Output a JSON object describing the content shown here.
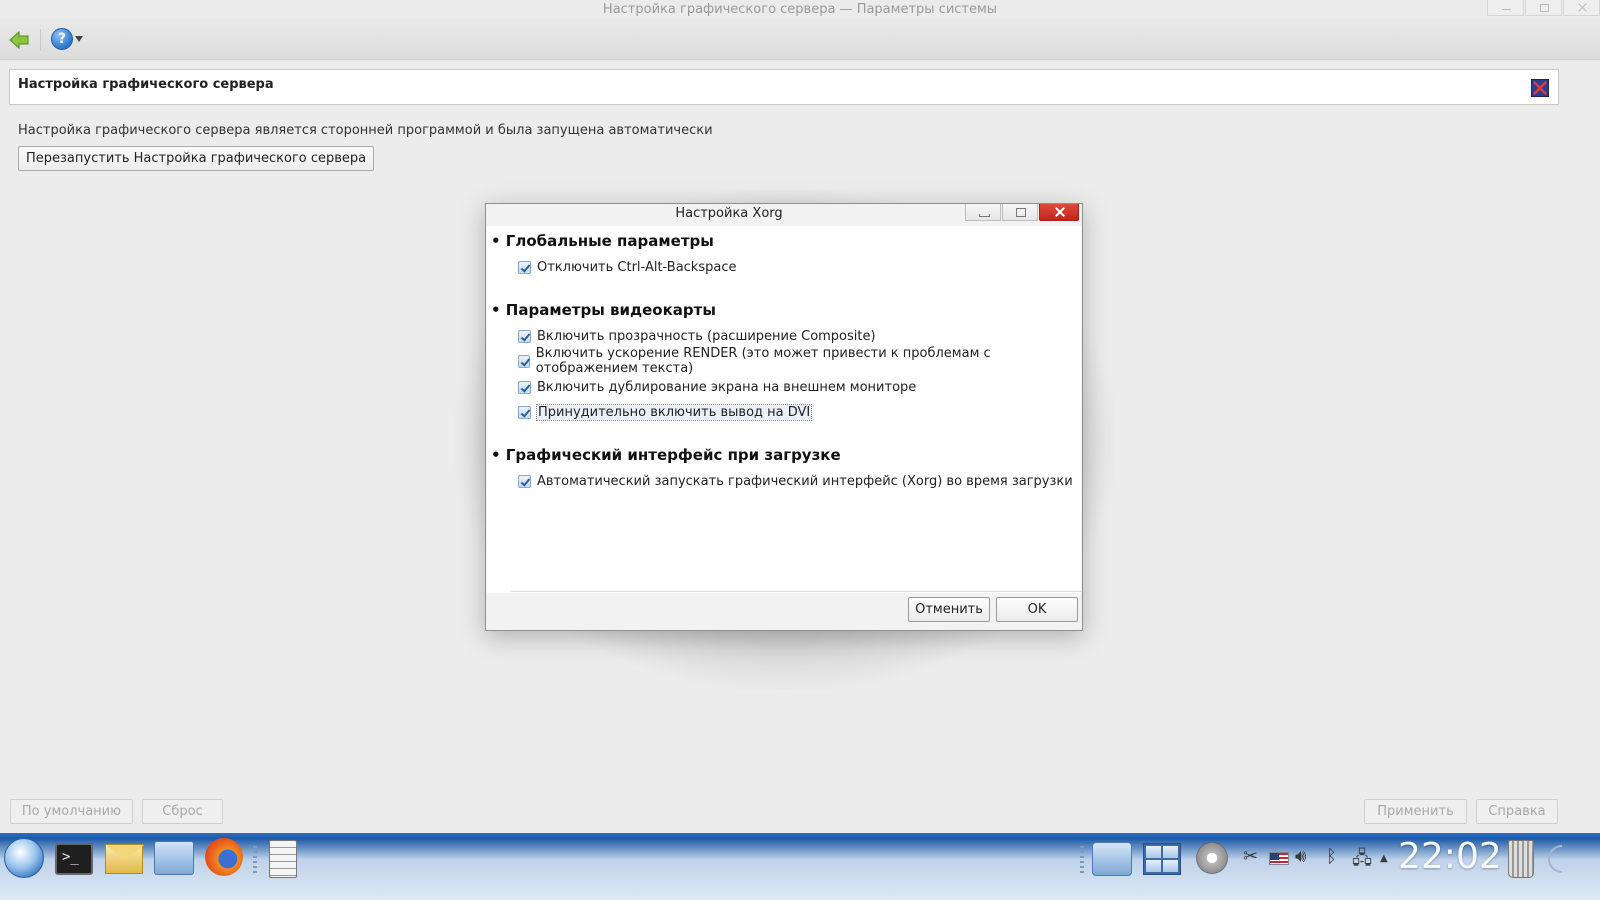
{
  "window": {
    "title": "Настройка графического сервера — Параметры системы"
  },
  "toolbar": {
    "back_icon": "back-arrow-icon",
    "help_icon": "help-icon",
    "help_symbol": "?"
  },
  "header": {
    "title": "Настройка графического сервера"
  },
  "main": {
    "info_text": "Настройка графического сервера является сторонней программой и была запущена автоматически",
    "restart_button": "Перезапустить Настройка графического сервера"
  },
  "footer": {
    "defaults_button": "По умолчанию",
    "reset_button": "Сброс",
    "apply_button": "Применить",
    "help_button": "Справка"
  },
  "dialog": {
    "title": "Настройка Xorg",
    "sections": [
      {
        "heading": "• Глобальные параметры",
        "options": [
          {
            "label": "Отключить Ctrl-Alt-Backspace",
            "checked": true
          }
        ]
      },
      {
        "heading": "• Параметры видеокарты",
        "options": [
          {
            "label": "Включить прозрачность (расширение Composite)",
            "checked": true
          },
          {
            "label": "Включить ускорение RENDER (это может привести к проблемам с отображением текста)",
            "checked": true
          },
          {
            "label": "Включить дублирование экрана на внешнем мониторе",
            "checked": true
          },
          {
            "label": "Принудительно включить вывод на DVI",
            "checked": true
          }
        ]
      },
      {
        "heading": "• Графический интерфейс при загрузке",
        "options": [
          {
            "label": "Автоматический запускать графический интерфейс (Xorg) во время загрузки",
            "checked": true
          }
        ]
      }
    ],
    "cancel_button": "Отменить",
    "ok_button": "OK"
  },
  "taskbar": {
    "clock": "22:02",
    "terminal_prompt": ">_",
    "tray_icons": [
      "clipboard-scissors-icon",
      "us-flag-icon",
      "volume-icon",
      "bluetooth-icon",
      "network-icon",
      "tray-expand-icon"
    ],
    "apps": [
      "menu-orb-icon",
      "terminal-icon",
      "mail-icon",
      "file-manager-icon",
      "firefox-icon",
      "drawer-icon",
      "workspace-icon",
      "pager-icon",
      "settings-icon",
      "trash-icon"
    ]
  }
}
